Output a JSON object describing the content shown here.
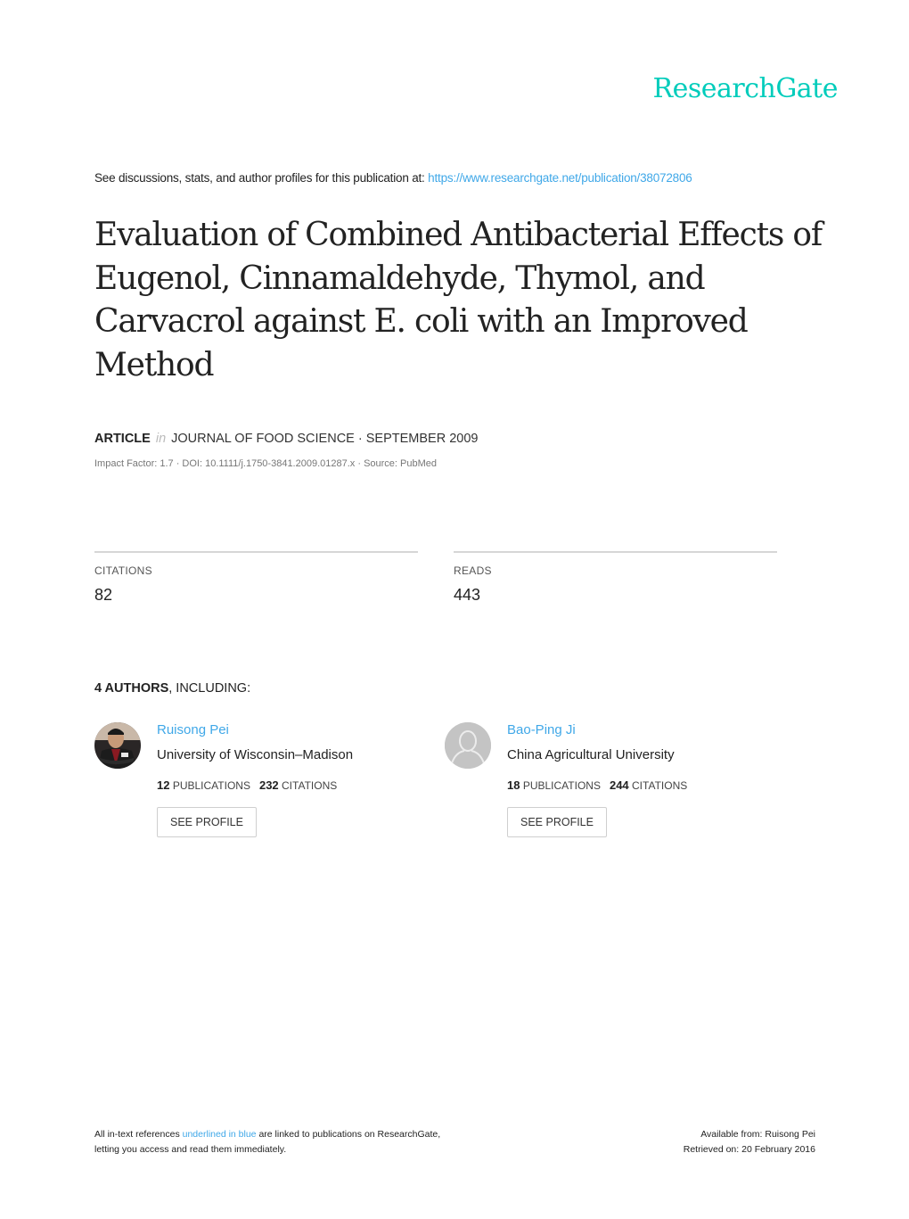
{
  "brand": {
    "logo_text": "ResearchGate",
    "accent_color": "#00ccbb",
    "link_color": "#40a8e8"
  },
  "header": {
    "see_prefix": "See discussions, stats, and author profiles for this publication at: ",
    "publication_url": "https://www.researchgate.net/publication/38072806"
  },
  "article": {
    "title": "Evaluation of Combined Antibacterial Effects of Eugenol, Cinnamaldehyde, Thymol, and Carvacrol against E. coli with an Improved Method",
    "type": "ARTICLE",
    "in_word": "in",
    "journal_date": "JOURNAL OF FOOD SCIENCE · SEPTEMBER 2009",
    "details": "Impact Factor: 1.7 · DOI: 10.1111/j.1750-3841.2009.01287.x · Source: PubMed"
  },
  "stats": {
    "citations_label": "CITATIONS",
    "citations_value": "82",
    "reads_label": "READS",
    "reads_value": "443"
  },
  "authors_section": {
    "count_label": "4 AUTHORS",
    "suffix": ", INCLUDING:",
    "authors": [
      {
        "name": "Ruisong Pei",
        "institution": "University of Wisconsin–Madison",
        "publications_count": "12",
        "publications_label": "PUBLICATIONS",
        "citations_count": "232",
        "citations_label": "CITATIONS",
        "button_label": "SEE PROFILE",
        "avatar": "photo"
      },
      {
        "name": "Bao-Ping Ji",
        "institution": "China Agricultural University",
        "publications_count": "18",
        "publications_label": "PUBLICATIONS",
        "citations_count": "244",
        "citations_label": "CITATIONS",
        "button_label": "SEE PROFILE",
        "avatar": "default-person-icon"
      }
    ]
  },
  "footer": {
    "left_prefix": "All in-text references ",
    "left_link": "underlined in blue",
    "left_suffix": " are linked to publications on ResearchGate,",
    "left_line2": "letting you access and read them immediately.",
    "available_from": "Available from: Ruisong Pei",
    "retrieved_on": "Retrieved on: 20 February 2016"
  }
}
